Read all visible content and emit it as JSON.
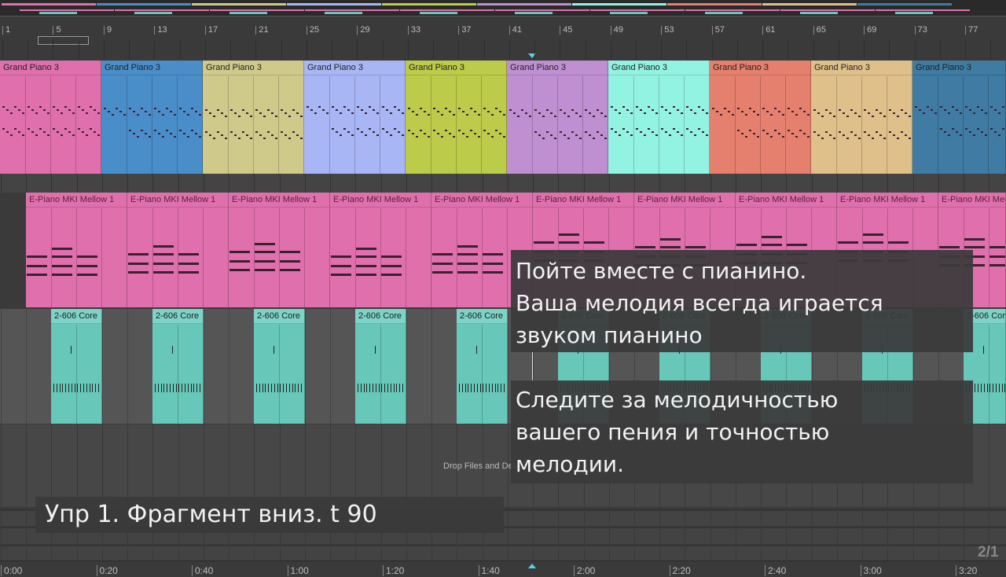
{
  "ruler": {
    "bars": [
      "1",
      "5",
      "9",
      "13",
      "17",
      "21",
      "25",
      "29",
      "33",
      "37",
      "41",
      "45",
      "49",
      "53",
      "57",
      "61",
      "65",
      "69",
      "73",
      "77"
    ]
  },
  "time_ruler": {
    "labels": [
      "0:00",
      "0:20",
      "0:40",
      "1:00",
      "1:20",
      "1:40",
      "2:00",
      "2:20",
      "2:40",
      "3:00",
      "3:20"
    ]
  },
  "tracks": {
    "grand_piano": {
      "clip_name": "Grand Piano 3",
      "colors": [
        "#e070ad",
        "#4a8ec9",
        "#cfca8a",
        "#a9b6f5",
        "#bccb4a",
        "#bf8fd1",
        "#93f3e2",
        "#e5806e",
        "#dfc08a",
        "#3f7ba3"
      ]
    },
    "epiano": {
      "clip_name": "E-Piano MKI Mellow 1",
      "color": "#e070ad"
    },
    "drums": {
      "clip_name": "2-606 Core",
      "color": "#67c7b9"
    }
  },
  "drop_hint": "Drop Files and Devices Here",
  "overlays": {
    "instruction1": [
      "Пойте вместе с пианино.",
      "Ваша мелодия всегда играется",
      "звуком пианино"
    ],
    "instruction2": [
      "Следите за мелодичностью",
      "вашего пения и точностью",
      "мелодии."
    ],
    "exercise_title": "Упр 1. Фрагмент вниз. t 90"
  },
  "page_indicator": "2/1",
  "accent": "#5ad0e0"
}
